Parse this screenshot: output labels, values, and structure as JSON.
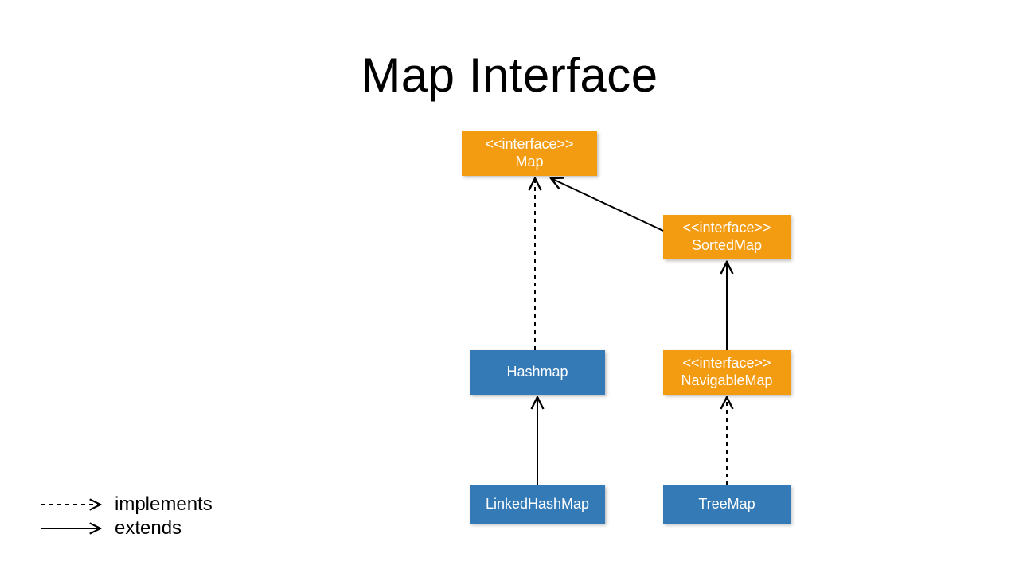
{
  "title": "Map Interface",
  "stereotype": "<<interface>>",
  "nodes": {
    "map": {
      "name": "Map",
      "kind": "interface"
    },
    "sortedmap": {
      "name": "SortedMap",
      "kind": "interface"
    },
    "navigablemap": {
      "name": "NavigableMap",
      "kind": "interface"
    },
    "hashmap": {
      "name": "Hashmap",
      "kind": "class"
    },
    "linkedhashmap": {
      "name": "LinkedHashMap",
      "kind": "class"
    },
    "treemap": {
      "name": "TreeMap",
      "kind": "class"
    }
  },
  "edges": [
    {
      "from": "hashmap",
      "to": "map",
      "type": "implements"
    },
    {
      "from": "sortedmap",
      "to": "map",
      "type": "extends"
    },
    {
      "from": "navigablemap",
      "to": "sortedmap",
      "type": "extends"
    },
    {
      "from": "linkedhashmap",
      "to": "hashmap",
      "type": "extends"
    },
    {
      "from": "treemap",
      "to": "navigablemap",
      "type": "implements"
    }
  ],
  "legend": {
    "implements": "implements",
    "extends": "extends"
  },
  "colors": {
    "interface": "#f39c12",
    "class": "#337ab7",
    "arrow": "#000000"
  }
}
